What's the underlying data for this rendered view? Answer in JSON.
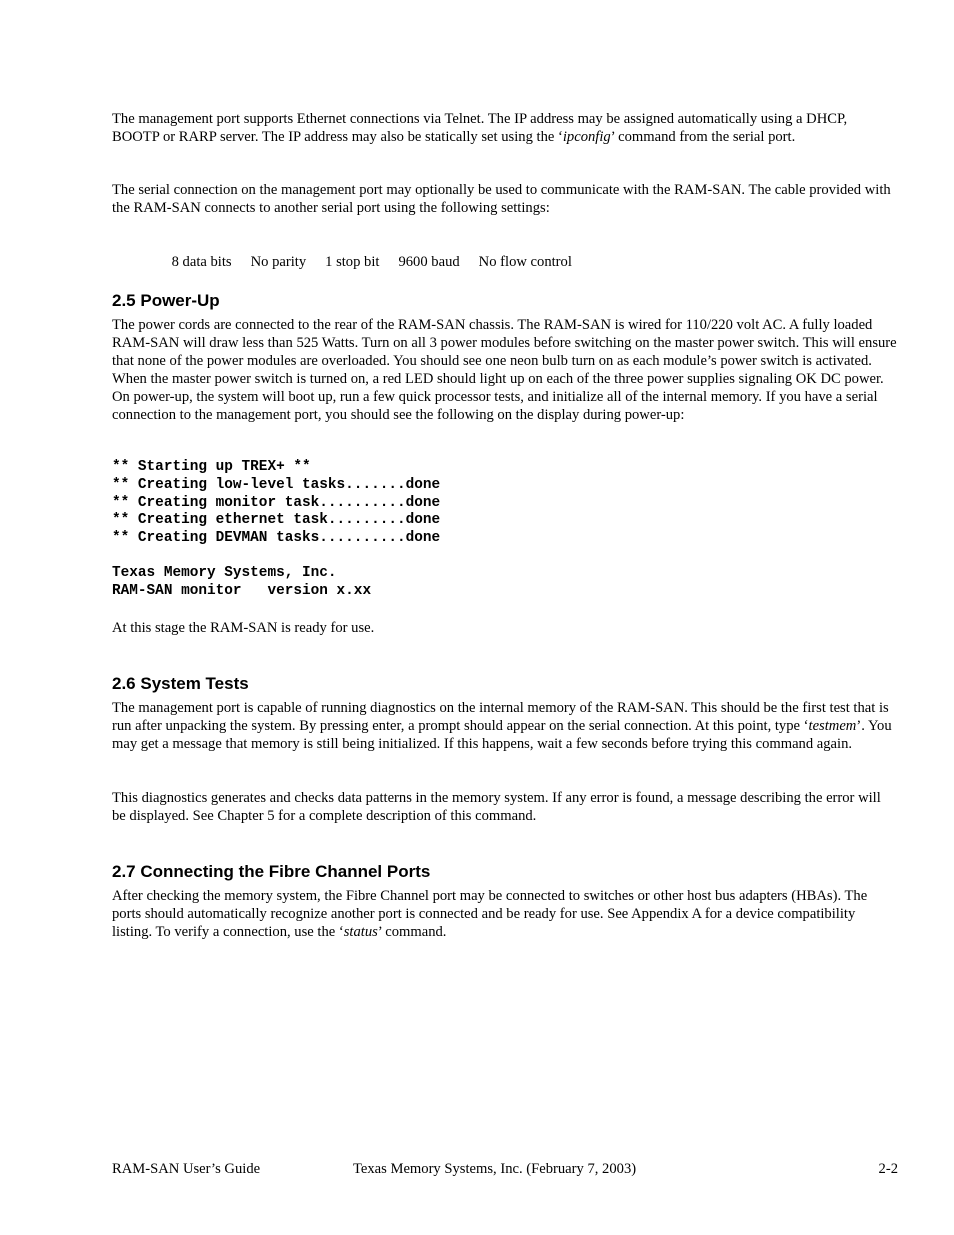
{
  "sections": {
    "intro": {
      "para1": {
        "before": "The management port supports Ethernet connections via Telnet.  The IP address may be assigned automatically using a DHCP, BOOTP or RARP server.  The IP address may also be statically set using the ‘",
        "cmd": "ipconfig",
        "after": "’ command from the serial port."
      },
      "para2": "The serial connection on the management port may optionally be used to communicate with the RAM-SAN.  The cable provided with the RAM-SAN connects to another serial port using the following settings:",
      "settings": [
        "8 data bits",
        "No parity",
        "1 stop bit",
        "9600 baud",
        "No flow control"
      ]
    },
    "power_up": {
      "heading": "2.5 Power-Up",
      "para": "The power cords are connected to the rear of the RAM-SAN chassis.  The RAM-SAN is wired for 110/220 volt AC.  A fully loaded RAM-SAN will draw less than 525 Watts.  Turn on all 3 power modules before switching on the master power switch.  This will ensure that none of the power modules are overloaded.  You should see one neon bulb turn on as each module’s power switch is activated.  When the master power switch is turned on, a red LED should light up on each of the three power supplies signaling OK DC power.  On power-up, the system will boot up, run a few quick processor tests, and initialize all of the internal memory.  If you have a serial connection to the management port, you should see the following on the display during power-up:",
      "console1": "** Starting up TREX+ **\n** Creating low-level tasks.......done\n** Creating monitor task..........done\n** Creating ethernet task.........done\n** Creating DEVMAN tasks..........done",
      "console2": "Texas Memory Systems, Inc.\nRAM-SAN monitor   version x.xx",
      "ready": "At this stage the RAM-SAN is ready for use."
    },
    "system_tests": {
      "heading": "2.6 System Tests",
      "para1": {
        "before": "The management port is capable of running diagnostics on the internal memory of the RAM-SAN.  This should be the first test that is run after unpacking the system.  By pressing enter, a prompt should appear on the serial connection.  At this point, type ‘",
        "cmd": "testmem",
        "after": "’.  You may get a message that memory is still being initialized.  If this happens, wait a few seconds before trying this command again."
      },
      "para2": "This diagnostics generates and checks data patterns in the memory system.  If any error is found, a message describing the error will be displayed.  See Chapter 5 for a complete description of this command."
    },
    "fibre_channel": {
      "heading": "2.7 Connecting the Fibre Channel Ports",
      "para": {
        "before": "After checking the memory system, the Fibre Channel port may be connected to switches or other host bus adapters (HBAs).  The ports should automatically recognize another port is connected and be ready for use.  See Appendix A for a device compatibility listing.  To verify a connection, use the ‘",
        "cmd": "status",
        "after": "’ command."
      }
    }
  },
  "footer": {
    "left": "RAM-SAN User’s Guide",
    "center": "Texas Memory Systems, Inc. (February 7, 2003)",
    "right": "2-2"
  }
}
